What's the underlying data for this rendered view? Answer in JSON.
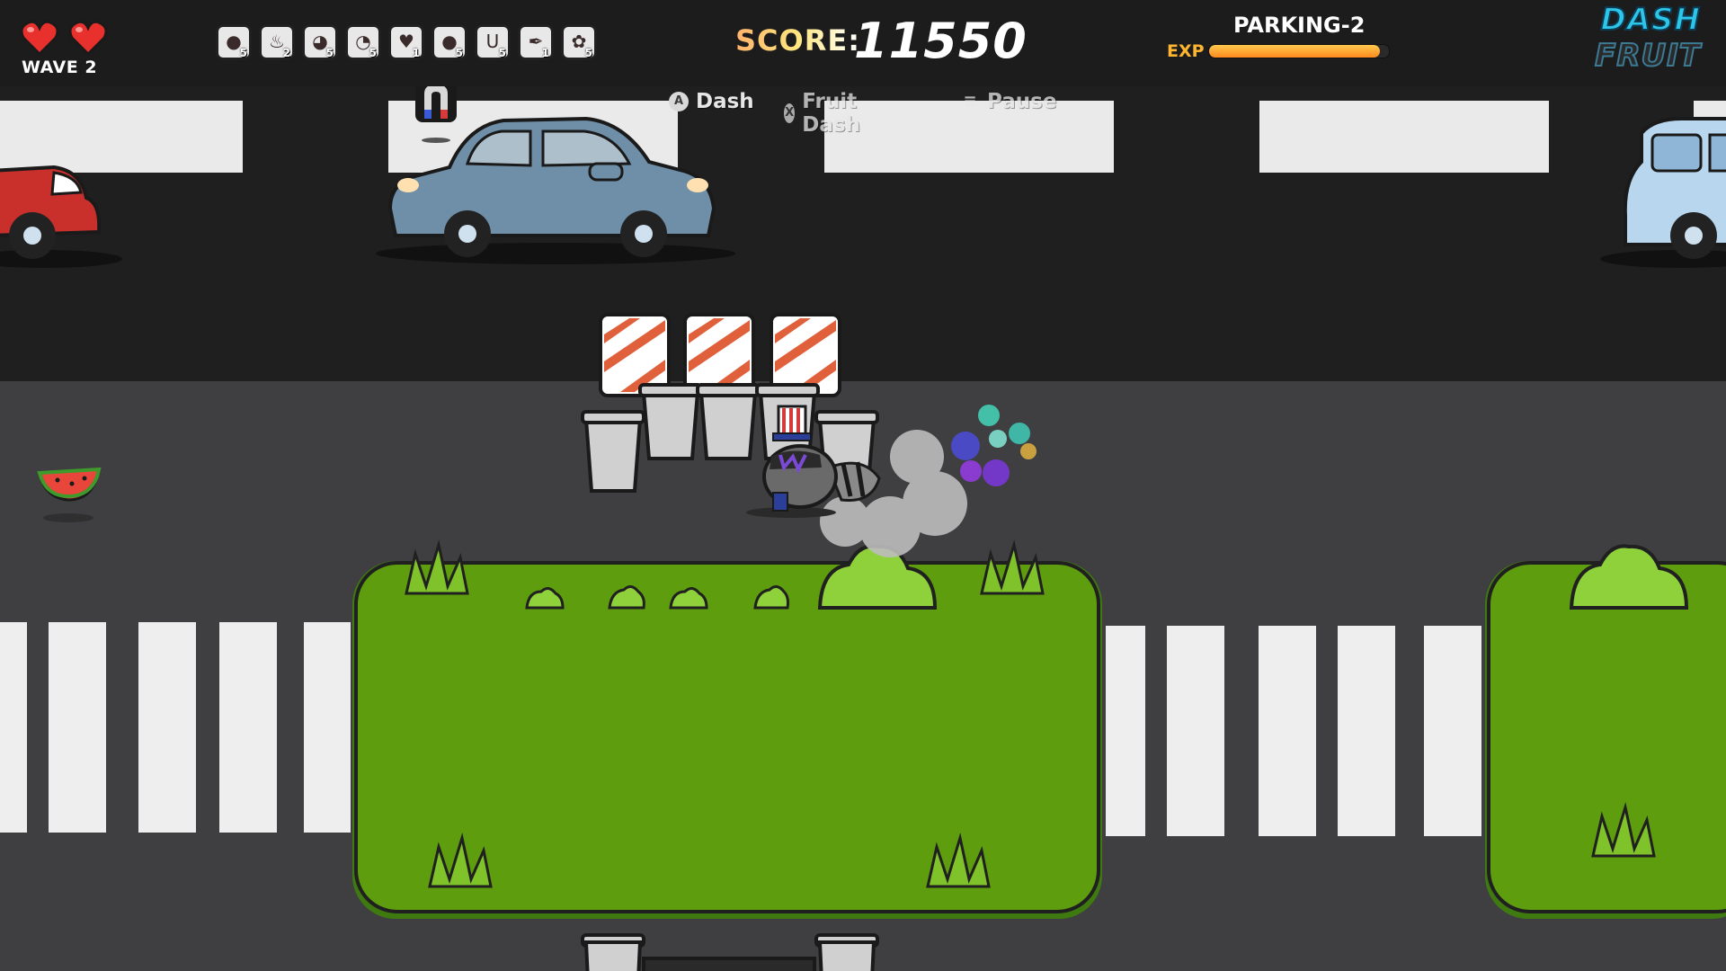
{
  "hud": {
    "hearts": 2,
    "wave": "WAVE 2",
    "upgrades": [
      {
        "icon": "dark-blob-icon",
        "glyph": "●",
        "count": "5"
      },
      {
        "icon": "chili-icon",
        "glyph": "♨",
        "count": "2"
      },
      {
        "icon": "snout-icon",
        "glyph": "◕",
        "count": "5"
      },
      {
        "icon": "clock-icon",
        "glyph": "◔",
        "count": "5"
      },
      {
        "icon": "heart-shield-icon",
        "glyph": "♥",
        "count": "1"
      },
      {
        "icon": "bomb-icon",
        "glyph": "●",
        "count": "5"
      },
      {
        "icon": "magnet-icon",
        "glyph": "U",
        "count": "5"
      },
      {
        "icon": "feather-icon",
        "glyph": "✒",
        "count": "1"
      },
      {
        "icon": "clover-icon",
        "glyph": "✿",
        "count": "5"
      }
    ],
    "score_label": "SCORE:",
    "score_value": "11550",
    "level_name": "PARKING-2",
    "exp_label": "EXP",
    "exp_progress": 0.95,
    "logo_line1": "DASH",
    "logo_line2": "FRUIT"
  },
  "controls": [
    {
      "button": "A",
      "label": "Dash"
    },
    {
      "button": "X",
      "label": "Fruit Dash"
    },
    {
      "button": "≡",
      "label": "Pause"
    }
  ],
  "colors": {
    "road_dark": "#1f1f1f",
    "asphalt": "#3f3f41",
    "grass": "#5e9e0e",
    "grass_edge": "#3f7a10",
    "car_blue": "#6f8fa8",
    "exp_fill": "#ff9a1e",
    "logo_cyan": "#2ec6e8"
  }
}
